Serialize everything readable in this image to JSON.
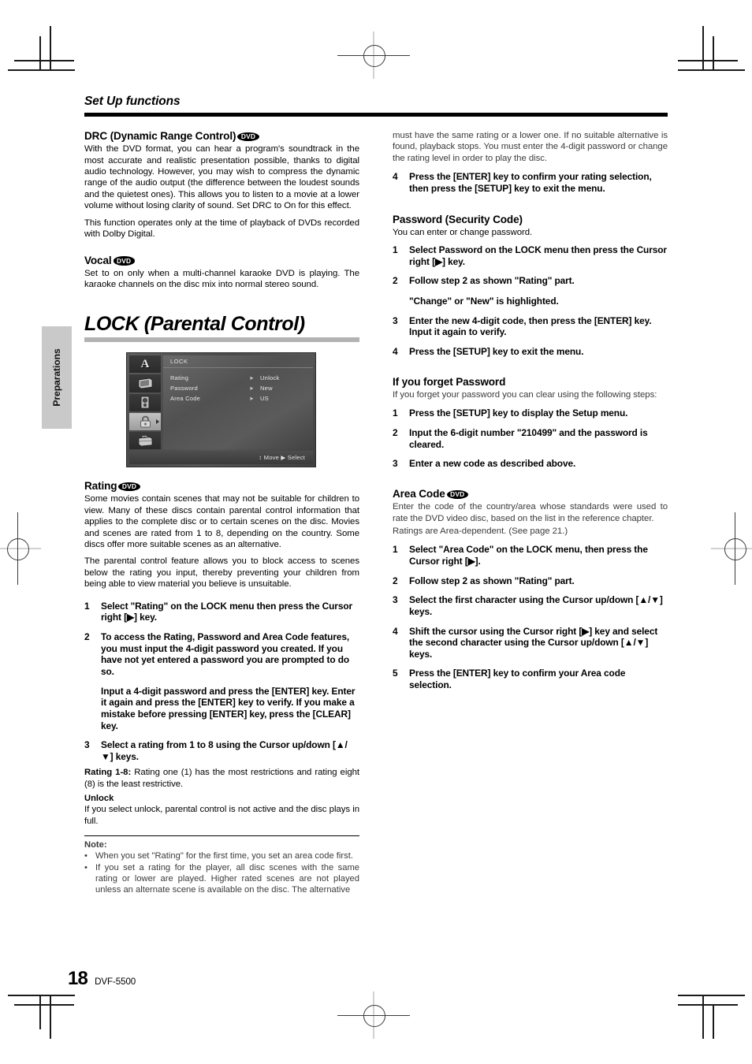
{
  "running_head": "Set Up functions",
  "side_tab": "Preparations",
  "footer": {
    "page_number": "18",
    "model": "DVF-5500"
  },
  "badges": {
    "dvd": "DVD"
  },
  "left_column": {
    "drc": {
      "heading": "DRC (Dynamic Range Control)",
      "para1": "With the DVD format, you can hear a program's soundtrack in the most accurate and realistic presentation possible, thanks to digital audio technology. However, you may wish to compress the dynamic range of the audio output (the difference between the loudest sounds and the quietest ones). This allows you to listen to a movie at a lower volume without losing clarity of sound. Set DRC to On for this effect.",
      "para2": "This function operates only at the time of playback of DVDs recorded with Dolby Digital."
    },
    "vocal": {
      "heading": "Vocal",
      "para1": "Set to on only when a multi-channel karaoke DVD is playing. The karaoke channels on the disc mix into normal stereo sound."
    },
    "lock_title": "LOCK (Parental Control)",
    "osd": {
      "title": "LOCK",
      "rows": [
        {
          "label": "Rating",
          "marker": "➤",
          "value": "Unlock"
        },
        {
          "label": "Password",
          "marker": "➤",
          "value": "New"
        },
        {
          "label": "Area Code",
          "marker": "➤",
          "value": "US"
        }
      ],
      "footer_hint": "↕ Move ▶ Select",
      "icons": [
        "language-a-icon",
        "display-icon",
        "audio-icon",
        "lock-icon",
        "others-briefcase-icon"
      ],
      "selected_icon_index": 3
    },
    "rating": {
      "heading": "Rating",
      "para1": "Some movies contain scenes that may not be suitable for children to view. Many of these discs contain parental control information that applies to the complete disc or to certain scenes on the disc. Movies and scenes are rated from 1 to 8, depending on the country. Some discs offer more suitable scenes as an alternative.",
      "para2": "The parental control feature allows you to block access to scenes below the rating you input, thereby preventing your children from being able to view material you believe is unsuitable.",
      "steps": [
        {
          "num": "1",
          "text": "Select \"Rating\" on the LOCK menu then press the Cursor right [▶] key."
        },
        {
          "num": "2",
          "text": "To access the Rating, Password and Area Code features, you must input the 4-digit password you created. If you have not yet entered a password you are prompted to do so.",
          "sub": "Input a 4-digit password and press the [ENTER] key. Enter it again and press the [ENTER] key to verify. If you make a mistake before pressing [ENTER] key, press the [CLEAR] key."
        },
        {
          "num": "3",
          "text": "Select a rating from 1 to 8 using the Cursor up/down [▲/▼] keys."
        }
      ],
      "rating_label": "Rating 1-8:",
      "rating_text": " Rating one (1) has the most restrictions and rating eight (8) is the least restrictive.",
      "unlock_label": "Unlock",
      "unlock_text": "If you select unlock, parental control is not active and the disc plays in full."
    },
    "note": {
      "title": "Note:",
      "items": [
        "When you set \"Rating\" for the first time, you set an area code first.",
        "If you set a rating for the player, all disc scenes with the same rating or lower are played. Higher rated scenes are not played unless an alternate scene is available on the disc. The alternative"
      ]
    }
  },
  "right_column": {
    "continuation": "must have the same rating or a lower one. If no suitable alternative is found, playback stops. You must enter the 4-digit password or change the rating level in order to play the disc.",
    "rating_step4": {
      "num": "4",
      "text": "Press the [ENTER] key to confirm your rating selection, then press the [SETUP] key to exit the menu."
    },
    "password": {
      "heading": "Password (Security Code)",
      "intro": "You can enter or change password.",
      "steps": [
        {
          "num": "1",
          "text": "Select Password on the LOCK menu then press the Cursor right [▶] key."
        },
        {
          "num": "2",
          "text": "Follow step 2 as shown \"Rating\" part.",
          "sub": "\"Change\" or \"New\" is highlighted."
        },
        {
          "num": "3",
          "text": "Enter the new 4-digit code, then press the [ENTER] key. Input it again to verify."
        },
        {
          "num": "4",
          "text": "Press the [SETUP] key to exit the menu."
        }
      ]
    },
    "forgot": {
      "heading": "If you forget Password",
      "intro": "If you forget your password you can clear using the following steps:",
      "steps": [
        {
          "num": "1",
          "text": "Press the [SETUP] key to display the Setup menu."
        },
        {
          "num": "2",
          "text": "Input the 6-digit number \"210499\" and the password is cleared."
        },
        {
          "num": "3",
          "text": "Enter a new code as described above."
        }
      ]
    },
    "area_code": {
      "heading": "Area Code",
      "para1": "Enter the code of the country/area whose standards were used to rate the DVD video disc, based on the list in the reference chapter.",
      "para2": "Ratings are Area-dependent. (See page 21.)",
      "steps": [
        {
          "num": "1",
          "text": "Select \"Area Code\" on the LOCK menu, then press the Cursor right [▶]."
        },
        {
          "num": "2",
          "text": "Follow step 2 as shown \"Rating\" part."
        },
        {
          "num": "3",
          "text": "Select the first character using the Cursor up/down [▲/▼] keys."
        },
        {
          "num": "4",
          "text": "Shift the cursor using the Cursor right [▶] key and select the second character using the Cursor up/down [▲/▼] keys."
        },
        {
          "num": "5",
          "text": "Press the [ENTER] key to confirm your Area code selection."
        }
      ]
    }
  }
}
